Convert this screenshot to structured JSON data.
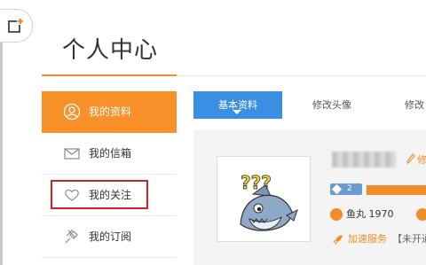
{
  "page": {
    "title": "个人中心"
  },
  "corner": {
    "icon": "add-window-icon",
    "accent": "#f28c2a"
  },
  "sidebar": {
    "items": [
      {
        "label": "我的资料",
        "icon": "user-icon",
        "active": true
      },
      {
        "label": "我的信箱",
        "icon": "mail-icon",
        "active": false
      },
      {
        "label": "我的关注",
        "icon": "heart-icon",
        "active": false,
        "highlighted": true
      },
      {
        "label": "我的订阅",
        "icon": "pin-icon",
        "active": false
      }
    ]
  },
  "tabs": [
    {
      "label": "基本资料",
      "active": true
    },
    {
      "label": "修改头像",
      "active": false
    },
    {
      "label": "修改",
      "active": false
    }
  ],
  "profile": {
    "avatar": "shark-avatar-icon",
    "edit_label": "修",
    "level": "2",
    "coins": "鱼丸 1970",
    "service_label": "加速服务",
    "service_status": "【未开通"
  },
  "colors": {
    "orange": "#f8912a",
    "blue": "#3a8fe4",
    "highlight_red": "#c9232b"
  }
}
